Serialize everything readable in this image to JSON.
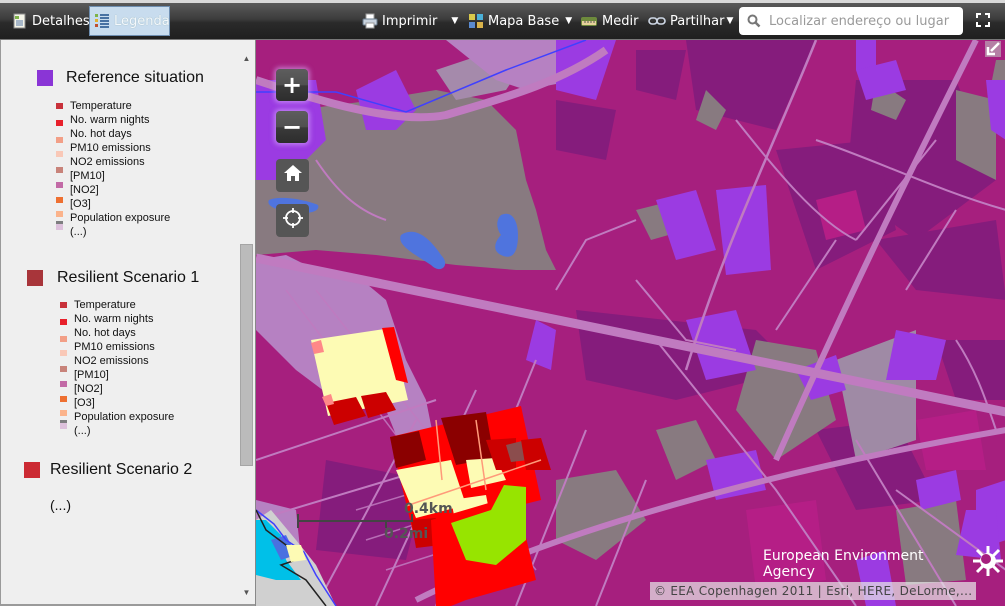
{
  "toolbar": {
    "details_label": "Detalhes",
    "legend_label": "Legenda",
    "print_label": "Imprimir",
    "basemap_label": "Mapa Base",
    "measure_label": "Medir",
    "share_label": "Partilhar",
    "search_placeholder": "Localizar endereço ou lugar",
    "icons": {
      "details": "document-icon",
      "legend": "legend-list-icon",
      "print": "printer-icon",
      "basemap": "basemap-grid-icon",
      "measure": "ruler-icon",
      "share": "link-icon",
      "search": "magnifier-icon",
      "fullscreen": "fullscreen-icon"
    }
  },
  "legend": {
    "layers": [
      {
        "title": "Reference situation",
        "color": "#8a35d6",
        "items": [
          {
            "label": "Temperature",
            "color": "#c8313a"
          },
          {
            "label": "No. warm nights",
            "color": "#e8202b"
          },
          {
            "label": "No. hot days",
            "color": ""
          },
          {
            "label": "PM10 emissions",
            "color": "#f29f87"
          },
          {
            "label": "NO2 emissions",
            "color": "#f9c8b7"
          },
          {
            "label": "[PM10]",
            "color": "#c8837a"
          },
          {
            "label": "[NO2]",
            "color": "#c26aa6"
          },
          {
            "label": "[O3]",
            "color": "#ee7031"
          },
          {
            "label": "Population exposure",
            "color": "#fbb38b"
          },
          {
            "label": "(...)",
            "color": "#7e7e80"
          }
        ],
        "extra_swatch": "#ddc1dc"
      },
      {
        "title": "Resilient Scenario 1",
        "color": "#a8353a",
        "items": [
          {
            "label": "Temperature",
            "color": "#c8313a"
          },
          {
            "label": "No. warm nights",
            "color": "#e8202b"
          },
          {
            "label": "No. hot days",
            "color": ""
          },
          {
            "label": "PM10 emissions",
            "color": "#f29f87"
          },
          {
            "label": "NO2 emissions",
            "color": "#f9c8b7"
          },
          {
            "label": "[PM10]",
            "color": "#c8837a"
          },
          {
            "label": "[NO2]",
            "color": "#c26aa6"
          },
          {
            "label": "[O3]",
            "color": "#ee7031"
          },
          {
            "label": "Population exposure",
            "color": "#fbb38b"
          },
          {
            "label": "(...)",
            "color": "#7e7e80"
          }
        ],
        "extra_swatch": "#ddc1dc"
      },
      {
        "title": "Resilient Scenario 2",
        "color": "#cc2a33",
        "more": "(...)"
      }
    ]
  },
  "map": {
    "controls": {
      "zoom_in": "+",
      "zoom_out": "−",
      "home_icon": "home-icon",
      "locate_icon": "locate-crosshair-icon"
    },
    "scale": {
      "km": "0.4km",
      "mi": "0.2mi"
    },
    "logo_text": "European Environment Agency",
    "attribution": "© EEA Copenhagen 2011 | Esri, HERE, DeLorme,..."
  }
}
